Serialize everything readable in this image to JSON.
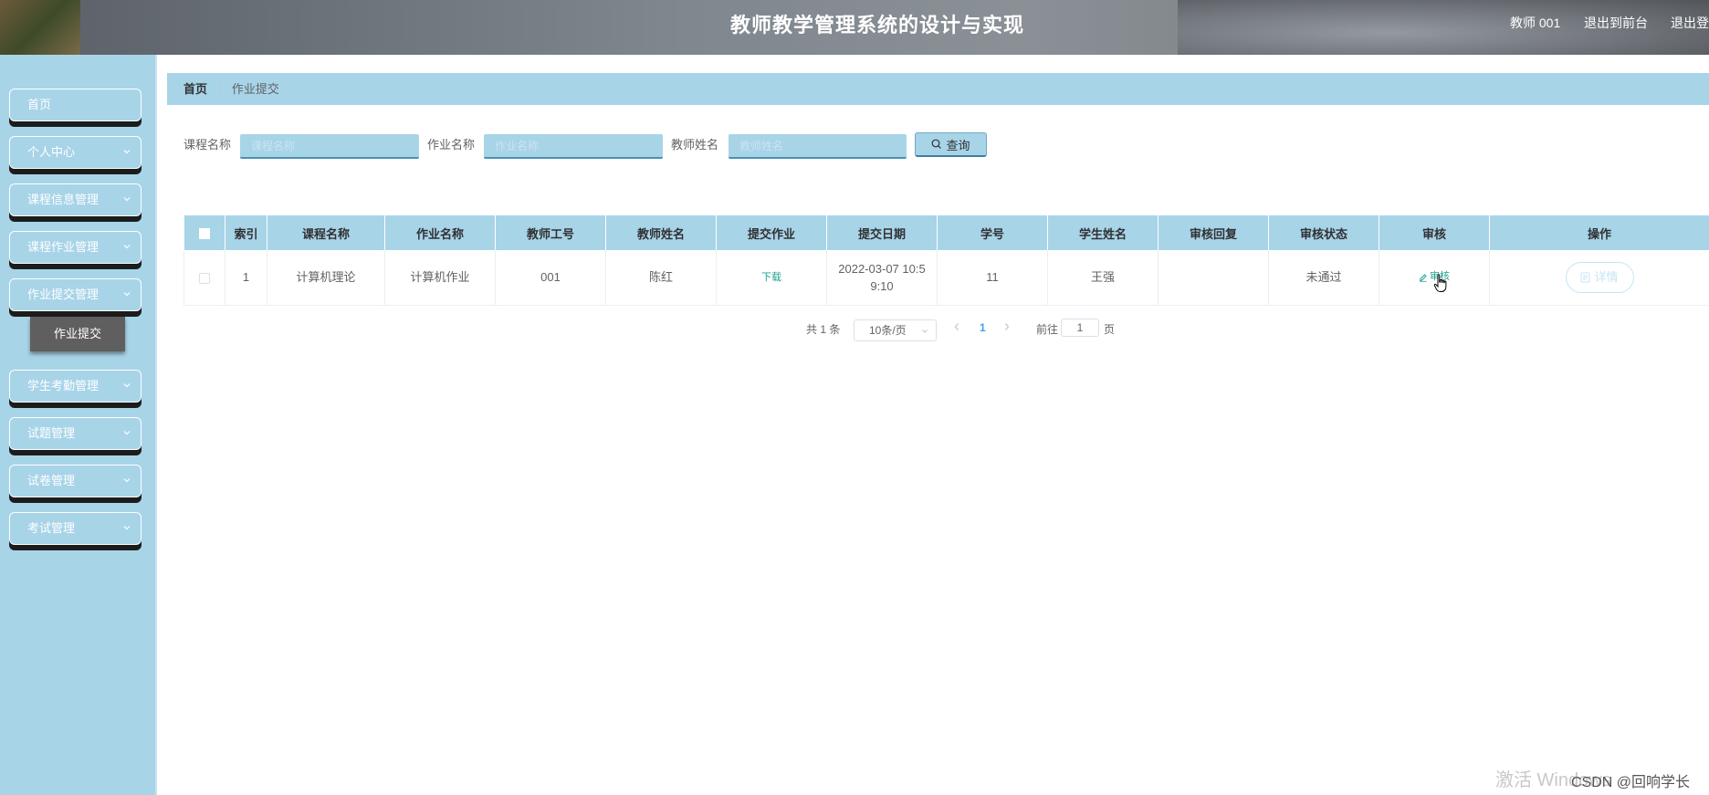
{
  "header": {
    "title": "教师教学管理系统的设计与实现",
    "user": "教师 001",
    "front_link": "退出到前台",
    "logout_link": "退出登"
  },
  "sidebar": {
    "items": [
      {
        "label": "首页",
        "has_chevron": false
      },
      {
        "label": "个人中心",
        "has_chevron": true
      },
      {
        "label": "课程信息管理",
        "has_chevron": true
      },
      {
        "label": "课程作业管理",
        "has_chevron": true
      },
      {
        "label": "作业提交管理",
        "has_chevron": true
      },
      {
        "label": "学生考勤管理",
        "has_chevron": true
      },
      {
        "label": "试题管理",
        "has_chevron": true
      },
      {
        "label": "试卷管理",
        "has_chevron": true
      },
      {
        "label": "考试管理",
        "has_chevron": true
      }
    ],
    "submenu_active": "作业提交"
  },
  "breadcrumb": {
    "home": "首页",
    "separator": "/",
    "current": "作业提交"
  },
  "search": {
    "course_label": "课程名称",
    "course_placeholder": "课程名称",
    "homework_label": "作业名称",
    "homework_placeholder": "作业名称",
    "teacher_label": "教师姓名",
    "teacher_placeholder": "教师姓名",
    "query_button": "查询"
  },
  "table": {
    "columns": [
      "索引",
      "课程名称",
      "作业名称",
      "教师工号",
      "教师姓名",
      "提交作业",
      "提交日期",
      "学号",
      "学生姓名",
      "审核回复",
      "审核状态",
      "审核",
      "操作"
    ],
    "rows": [
      {
        "index": "1",
        "course": "计算机理论",
        "homework": "计算机作业",
        "teacher_no": "001",
        "teacher_name": "陈红",
        "submit_link": "下载",
        "submit_date": "2022-03-07 10:5 9:10",
        "student_no": "11",
        "student_name": "王强",
        "reply": "",
        "status": "未通过",
        "audit_link": "审核",
        "detail_button": "详情"
      }
    ]
  },
  "pagination": {
    "total": "共 1 条",
    "page_size": "10条/页",
    "current_page": "1",
    "goto_label": "前往",
    "goto_value": "1",
    "page_word": "页"
  },
  "watermark": {
    "line1": "激活 Windows",
    "csdn": "CSDN @回响学长"
  },
  "colors": {
    "sidebar_bg": "#a8d4e8",
    "accent": "#20a090",
    "active_submenu": "#5f5f5f"
  }
}
